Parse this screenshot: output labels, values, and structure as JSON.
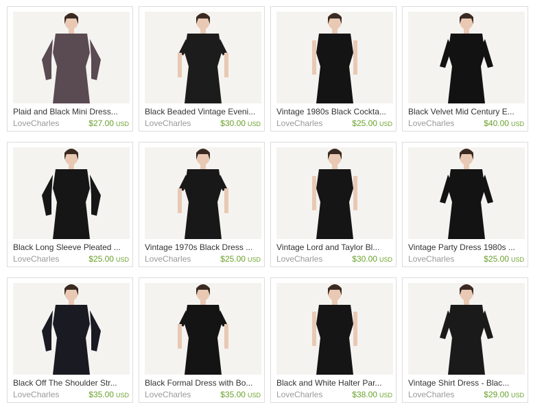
{
  "listings": [
    {
      "title": "Plaid and Black Mini Dress...",
      "shop": "LoveCharles",
      "price": "$27.00",
      "currency": "USD",
      "accent": "#5a4a52"
    },
    {
      "title": "Black Beaded Vintage Eveni...",
      "shop": "LoveCharles",
      "price": "$30.00",
      "currency": "USD",
      "accent": "#1c1c1c"
    },
    {
      "title": "Vintage 1980s Black Cockta...",
      "shop": "LoveCharles",
      "price": "$25.00",
      "currency": "USD",
      "accent": "#141414"
    },
    {
      "title": "Black Velvet Mid Century E...",
      "shop": "LoveCharles",
      "price": "$40.00",
      "currency": "USD",
      "accent": "#121212"
    },
    {
      "title": "Black Long Sleeve Pleated ...",
      "shop": "LoveCharles",
      "price": "$25.00",
      "currency": "USD",
      "accent": "#161616"
    },
    {
      "title": "Vintage 1970s Black Dress ...",
      "shop": "LoveCharles",
      "price": "$25.00",
      "currency": "USD",
      "accent": "#181818"
    },
    {
      "title": "Vintage Lord and Taylor Bl...",
      "shop": "LoveCharles",
      "price": "$30.00",
      "currency": "USD",
      "accent": "#151515"
    },
    {
      "title": "Vintage Party Dress 1980s ...",
      "shop": "LoveCharles",
      "price": "$25.00",
      "currency": "USD",
      "accent": "#131313"
    },
    {
      "title": "Black Off The Shoulder Str...",
      "shop": "LoveCharles",
      "price": "$35.00",
      "currency": "USD",
      "accent": "#1a1a22"
    },
    {
      "title": "Black Formal Dress with Bo...",
      "shop": "LoveCharles",
      "price": "$35.00",
      "currency": "USD",
      "accent": "#141414"
    },
    {
      "title": "Black and White Halter Par...",
      "shop": "LoveCharles",
      "price": "$38.00",
      "currency": "USD",
      "accent": "#151515"
    },
    {
      "title": "Vintage Shirt Dress - Blac...",
      "shop": "LoveCharles",
      "price": "$29.00",
      "currency": "USD",
      "accent": "#1a1a1a"
    }
  ]
}
